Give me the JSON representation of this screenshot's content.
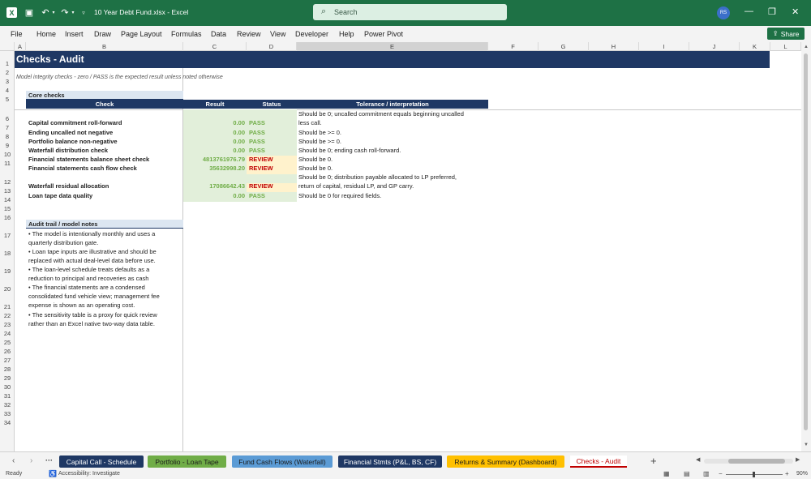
{
  "window": {
    "title": "10 Year Debt Fund.xlsx  -  Excel",
    "search_placeholder": "Search",
    "user_initials": "RS",
    "accent": "#1e7145"
  },
  "menu": {
    "items": [
      "File",
      "Home",
      "Insert",
      "Draw",
      "Page Layout",
      "Formulas",
      "Data",
      "Review",
      "View",
      "Developer",
      "Help",
      "Power Pivot"
    ],
    "share_label": "Share"
  },
  "columns": [
    "A",
    "B",
    "C",
    "D",
    "E",
    "F",
    "G",
    "H",
    "I",
    "J",
    "K",
    "L"
  ],
  "rows": [
    "1",
    "2",
    "3",
    "4",
    "5",
    "6",
    "7",
    "8",
    "9",
    "10",
    "11",
    "12",
    "13",
    "14",
    "15",
    "16",
    "17",
    "18",
    "19",
    "20",
    "21",
    "22",
    "23",
    "24",
    "25",
    "26",
    "27",
    "28",
    "29",
    "30",
    "31",
    "32",
    "33",
    "34"
  ],
  "sheet": {
    "title": "Checks - Audit",
    "subtitle": "Model integrity checks - zero / PASS is the expected result unless noted otherwise",
    "core_header": "Core checks",
    "table_headers": [
      "Check",
      "Result",
      "Status",
      "Tolerance / interpretation"
    ],
    "checks": [
      {
        "name": "Capital commitment roll-forward",
        "result": "0.00",
        "status": "PASS",
        "tol": [
          "Should be 0; uncalled commitment equals beginning uncalled",
          "less call."
        ]
      },
      {
        "name": "Ending uncalled not negative",
        "result": "0.00",
        "status": "PASS",
        "tol": [
          "Should be >= 0."
        ]
      },
      {
        "name": "Portfolio balance non-negative",
        "result": "0.00",
        "status": "PASS",
        "tol": [
          "Should be >= 0."
        ]
      },
      {
        "name": "Waterfall distribution check",
        "result": "0.00",
        "status": "PASS",
        "tol": [
          "Should be 0; ending cash roll-forward."
        ]
      },
      {
        "name": "Financial statements balance sheet check",
        "result": "4813761976.79",
        "status": "REVIEW",
        "tol": [
          "Should be 0."
        ]
      },
      {
        "name": "Financial statements cash flow check",
        "result": "35632998.20",
        "status": "REVIEW",
        "tol": [
          "Should be 0."
        ]
      },
      {
        "name": "Waterfall residual allocation",
        "result": "17086642.43",
        "status": "REVIEW",
        "tol": [
          "Should be 0; distribution payable allocated to LP preferred,",
          "return of capital, residual LP, and GP carry."
        ]
      },
      {
        "name": "Loan tape data quality",
        "result": "0.00",
        "status": "PASS",
        "tol": [
          "Should be 0 for required fields."
        ]
      }
    ],
    "audit_header": "Audit trail / model notes",
    "notes": [
      [
        "• The model is intentionally monthly and uses a",
        "quarterly distribution gate."
      ],
      [
        "• Loan tape inputs are illustrative and should be",
        "replaced with actual deal-level data before use."
      ],
      [
        "• The loan-level schedule treats defaults as a",
        "reduction to principal and recoveries as cash"
      ],
      [
        "• The financial statements are a condensed",
        "consolidated fund vehicle view; management fee",
        "expense is shown as an operating cost."
      ],
      [
        "• The sensitivity table is a proxy for quick review",
        "rather than an Excel native two-way data table."
      ]
    ]
  },
  "tabs": [
    {
      "label": "Capital Call - Schedule",
      "color": "#1f3864",
      "text": "#ffffff"
    },
    {
      "label": "Portfolio - Loan Tape",
      "color": "#70ad47",
      "text": "#1a1a1a"
    },
    {
      "label": "Fund Cash Flows (Waterfall)",
      "color": "#5b9bd5",
      "text": "#1a1a1a"
    },
    {
      "label": "Financial Stmts (P&L, BS, CF)",
      "color": "#1f3864",
      "text": "#ffffff"
    },
    {
      "label": "Returns & Summary (Dashboard)",
      "color": "#ffc000",
      "text": "#1a1a1a"
    },
    {
      "label": "Checks - Audit",
      "color": "#ffffff",
      "text": "#c00000"
    }
  ],
  "status": {
    "ready": "Ready",
    "accessibility": "Accessibility: Investigate",
    "zoom": "90%"
  },
  "colors": {
    "navy": "#1f3864",
    "pass_fill": "#e2efda",
    "pass_text": "#70ad47",
    "review_fill": "#fff2cc",
    "review_text": "#c00000",
    "band": "#dce6f1"
  }
}
